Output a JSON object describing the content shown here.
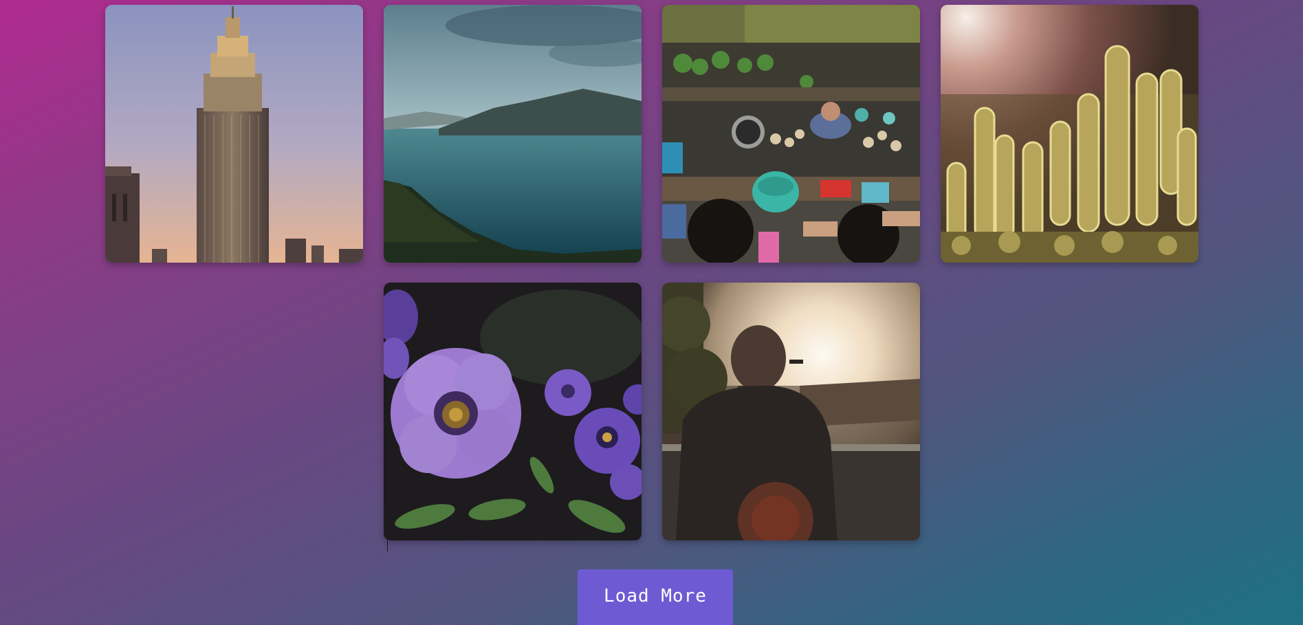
{
  "gallery": {
    "photos": [
      {
        "name": "empire-state-building-photo"
      },
      {
        "name": "lake-mountains-photo"
      },
      {
        "name": "floating-market-photo"
      },
      {
        "name": "cactus-sunlight-photo"
      },
      {
        "name": "purple-petunia-photo"
      },
      {
        "name": "man-sunset-photo"
      }
    ]
  },
  "load_more": {
    "label": "Load More"
  },
  "colors": {
    "button": "#6e5bd3",
    "background_start": "#b02a8f",
    "background_end": "#1f7182"
  }
}
